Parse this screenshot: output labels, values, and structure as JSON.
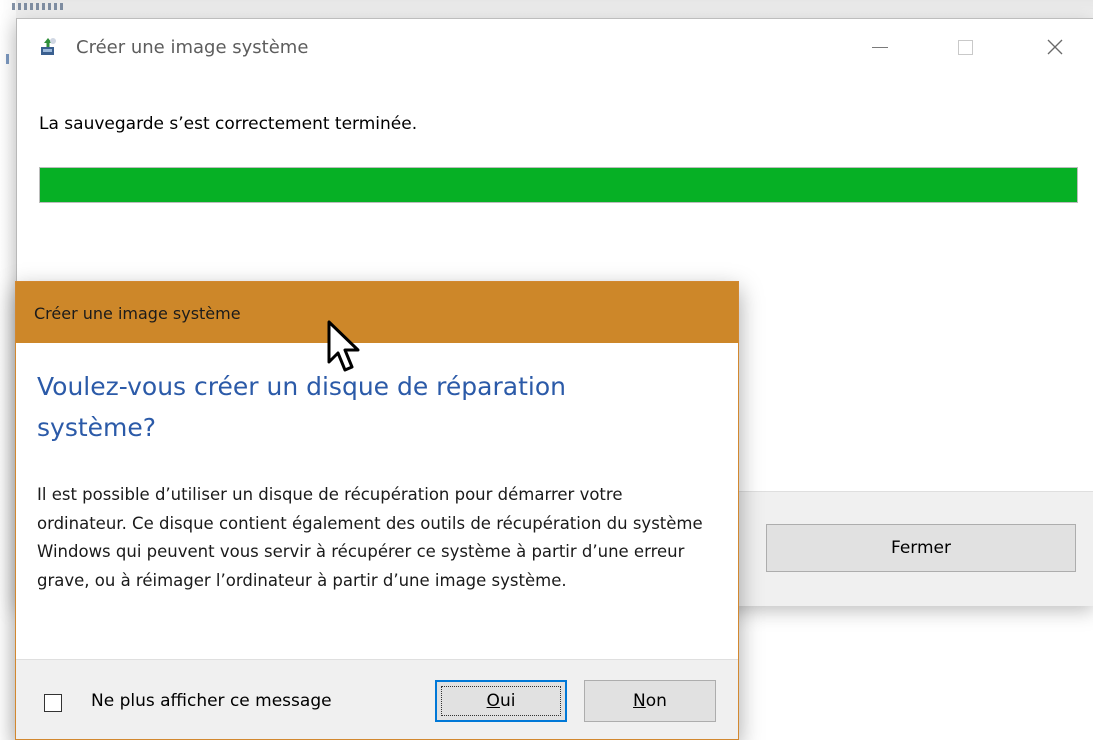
{
  "main_window": {
    "title": "Créer une image système",
    "icon": "backup-app-icon",
    "message": "La sauvegarde s’est correctement terminée.",
    "progress_fraction": 1.0,
    "progress_color": "#06b025",
    "close_button": "Fermer"
  },
  "dialog": {
    "title": "Créer une image système",
    "title_bar_color": "#cd8729",
    "heading": "Voulez-vous créer un disque de réparation système?",
    "heading_color": "#2b5aa8",
    "body": "Il est possible d’utiliser un disque de récupération pour démarrer votre ordinateur. Ce disque contient également des outils de récupération du système Windows qui peuvent vous servir à récupérer ce système à partir d’une erreur grave, ou à réimager l’ordinateur à partir d’une image système.",
    "checkbox_label": "Ne plus afficher ce message",
    "checkbox_checked": false,
    "yes_button": {
      "accesskey": "O",
      "rest": "ui"
    },
    "no_button": {
      "accesskey": "N",
      "rest": "on"
    }
  }
}
